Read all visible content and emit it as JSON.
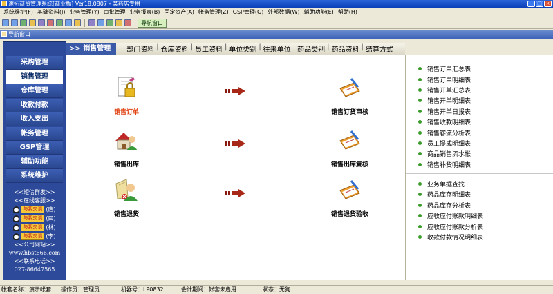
{
  "titlebar": {
    "title": "速拓商贸管理系统[商业版] Ver18.0807 - 某药店专用"
  },
  "menubar": {
    "items": [
      "系统维护(F)",
      "基础资料(J)",
      "业务管理(Y)",
      "审批管理",
      "业务报表(B)",
      "固定资产(A)",
      "帐务管理(Z)",
      "GSP管理(G)",
      "外部数据(W)",
      "辅助功能(E)",
      "帮助(H)"
    ]
  },
  "toolbar": {
    "nav_window_label": "导航窗口"
  },
  "subwindow": {
    "title": "导航窗口"
  },
  "sidebar": {
    "items": [
      "采购管理",
      "销售管理",
      "仓库管理",
      "收款付款",
      "收入支出",
      "帐务管理",
      "GSP管理",
      "辅助功能",
      "系统维护"
    ],
    "active_index": 1,
    "sms_link": "<<短信群发>>",
    "service_link": "<<在线客服>>",
    "qq_badge": "与我交谈",
    "qq_contacts": [
      "(唐)",
      "(曰)",
      "(林)",
      "(李)"
    ],
    "company_link": "<<公司网站>>",
    "website": "www.hbst666.com",
    "phone_link": "<<联系电话>>",
    "phone": "027-86647565"
  },
  "breadcrumb": {
    "current": ">> 销售管理",
    "links": [
      "部门资料",
      "仓库资料",
      "员工资料",
      "单位类别",
      "往来单位",
      "药品类别",
      "药品资料",
      "结算方式"
    ]
  },
  "flow": {
    "order": "销售订单",
    "order_review": "销售订货审核",
    "outbound": "销售出库",
    "outbound_review": "销售出库复核",
    "return": "销售退货",
    "return_check": "销售退货验收"
  },
  "reports": {
    "group1": [
      "销售订单汇总表",
      "销售订单明细表",
      "销售开单汇总表",
      "销售开单明细表",
      "销售开单日报表",
      "销售收款明细表",
      "销售客流分析表",
      "员工提成明细表",
      "商品销售流水帐",
      "销售补货明细表"
    ],
    "group2": [
      "业务单据查找",
      "药品库存明细表",
      "药品库存分析表",
      "应收应付账款明细表",
      "应收应付账款分析表",
      "收款付款情况明细表"
    ]
  },
  "statusbar": {
    "account": "帐套名称：演示帐套",
    "operator": "操作员：管理员",
    "machine": "机器号：LP0832",
    "period": "会计期间：帐套未启用",
    "status": "状态：无狗"
  },
  "colors": {
    "sidebar_bg": "#2d4a9a",
    "accent_red": "#e04010",
    "dot_green": "#3a9a2a"
  }
}
